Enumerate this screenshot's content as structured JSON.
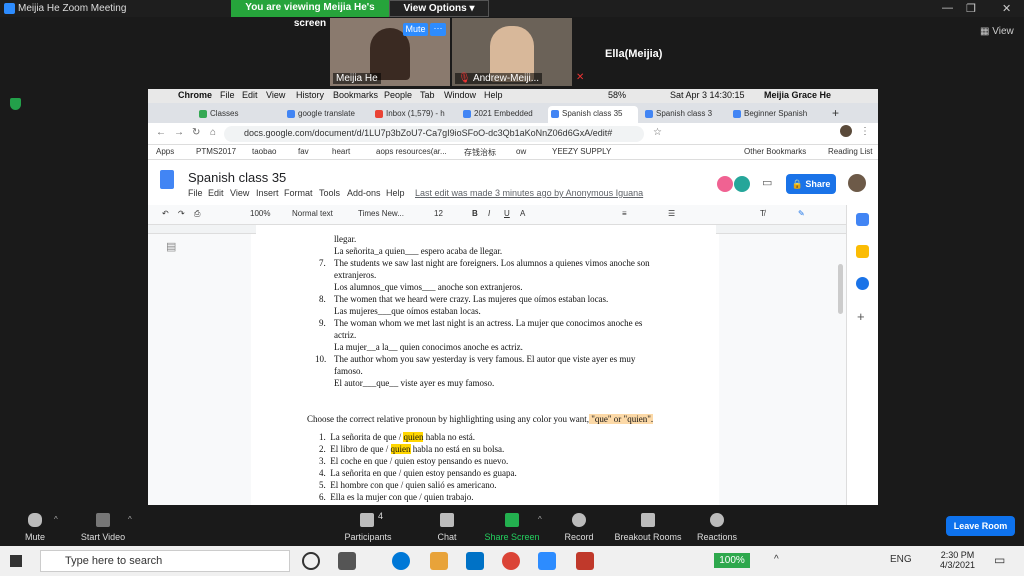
{
  "zoom": {
    "window_title": "Meijia He   Zoom Meeting",
    "banner": "You are viewing Meijia He's screen",
    "view_options": "View Options",
    "participants": [
      {
        "name": "Meijia He"
      },
      {
        "name": "Andrew-Meiji..."
      }
    ],
    "mute_tile_btn": "Mute",
    "more_btn": "···",
    "ella_label": "Ella(Meijia)",
    "view_label": "View",
    "toolbar": {
      "mute": "Mute",
      "start_video": "Start Video",
      "participants": "Participants",
      "participants_count": "4",
      "chat": "Chat",
      "share_screen": "Share Screen",
      "record": "Record",
      "breakout": "Breakout Rooms",
      "reactions": "Reactions",
      "leave": "Leave Room"
    }
  },
  "mac_menu": {
    "app": "Chrome",
    "items": [
      "File",
      "Edit",
      "View",
      "History",
      "Bookmarks",
      "People",
      "Tab",
      "Window",
      "Help"
    ],
    "battery": "58%",
    "datetime": "Sat Apr 3  14:30:15",
    "user": "Meijia Grace He"
  },
  "tabs": [
    {
      "label": "Classes",
      "color": "#34a853"
    },
    {
      "label": "google translate",
      "color": "#4285f4"
    },
    {
      "label": "Inbox (1,579) - h",
      "color": "#ea4335"
    },
    {
      "label": "2021 Embedded",
      "color": "#4285f4"
    },
    {
      "label": "Spanish class 35",
      "color": "#4285f4",
      "active": true
    },
    {
      "label": "Spanish class 3",
      "color": "#4285f4"
    },
    {
      "label": "Beginner Spanish",
      "color": "#4285f4"
    }
  ],
  "url": "docs.google.com/document/d/1LU7p3bZoU7-Ca7gI9ioSFoO-dc3Qb1aKoNnZ06d6GxA/edit#",
  "bookmarks": [
    "Apps",
    "PTMS2017",
    "taobao",
    "fav",
    "heart",
    "aops resources(ar...",
    "存钱治标",
    "ow",
    "YEEZY SUPPLY",
    "Other Bookmarks",
    "Reading List"
  ],
  "doc": {
    "title": "Spanish class 35",
    "menu": [
      "File",
      "Edit",
      "View",
      "Insert",
      "Format",
      "Tools",
      "Add-ons",
      "Help"
    ],
    "last_edit": "Last edit was made 3 minutes ago by Anonymous Iguana",
    "share": "Share",
    "zoom": "100%",
    "style": "Normal text",
    "font": "Times New...",
    "font_size": "12",
    "lines": [
      {
        "t": "llegar."
      },
      {
        "t": "La señorita_a quien___  espero acaba de llegar."
      },
      {
        "n": "7.",
        "t": "The students we saw last night are foreigners. Los alumnos a quienes vimos anoche son"
      },
      {
        "t": "extranjeros."
      },
      {
        "t": "Los alumnos_que vimos___  anoche son extranjeros."
      },
      {
        "n": "8.",
        "t": "The women that we heard were crazy. Las mujeres que oímos estaban locas."
      },
      {
        "t": "Las mujeres___que  oímos estaban locas."
      },
      {
        "n": "9.",
        "t": "The woman whom we met last night is an actress. La mujer que conocimos anoche es"
      },
      {
        "t": "actriz."
      },
      {
        "t": "La mujer__a la__  quien conocimos anoche es actriz."
      },
      {
        "n": "10.",
        "t": "The author whom you saw yesterday is very famous. El autor que viste ayer es muy"
      },
      {
        "t": "famoso."
      },
      {
        "t": "El autor___que__  viste ayer es muy famoso."
      }
    ],
    "instruction": "Choose the correct relative pronoun by highlighting using any color you want,",
    "instruction_hl": " \"que\" or \"quien\".",
    "exercises": [
      {
        "n": "1.",
        "a": "La señorita de que / ",
        "h": "quien",
        "b": "  habla no está."
      },
      {
        "n": "2.",
        "a": "El libro de que / ",
        "h": "quien",
        "b": "  habla no está en su bolsa."
      },
      {
        "n": "3.",
        "a": "El coche en que / quien  estoy pensando es nuevo.",
        "h": "",
        "b": ""
      },
      {
        "n": "4.",
        "a": "La señorita en que / quien  estoy pensando es guapa.",
        "h": "",
        "b": ""
      },
      {
        "n": "5.",
        "a": "El hombre con que / quien  salió es americano.",
        "h": "",
        "b": ""
      },
      {
        "n": "6.",
        "a": "Ella es la mujer con que / quien  trabajo.",
        "h": "",
        "b": ""
      }
    ]
  },
  "taskbar": {
    "search": "Type here to search",
    "zoom_pct": "100%",
    "lang": "ENG",
    "time": "2:30 PM",
    "date": "4/3/2021"
  }
}
